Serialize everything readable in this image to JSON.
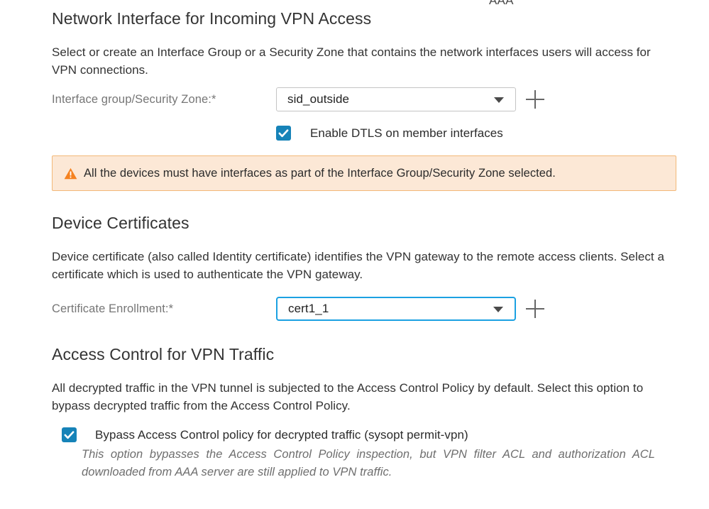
{
  "clipped_top_label": "AAA",
  "sections": {
    "network_interface": {
      "heading": "Network Interface for Incoming VPN Access",
      "description": "Select or create an Interface Group or a Security Zone that contains the network interfaces users will access for VPN connections.",
      "field_label": "Interface group/Security Zone:*",
      "selected_value": "sid_outside",
      "add_icon": "plus-icon",
      "caret_icon": "chevron-down-icon",
      "dtls_checkbox_label": "Enable DTLS on member interfaces",
      "dtls_checked": true,
      "warning": {
        "icon": "warning-triangle-icon",
        "text": "All the devices must have interfaces as part of the Interface Group/Security Zone selected."
      }
    },
    "device_certificates": {
      "heading": "Device Certificates",
      "description": "Device certificate (also called Identity certificate) identifies the VPN gateway to the remote access clients. Select a certificate which is used to authenticate the VPN gateway.",
      "field_label": "Certificate Enrollment:*",
      "selected_value": "cert1_1",
      "add_icon": "plus-icon",
      "caret_icon": "chevron-down-icon",
      "focused": true
    },
    "access_control": {
      "heading": "Access Control for VPN Traffic",
      "description": "All decrypted traffic in the VPN tunnel is subjected to the Access Control Policy by default. Select this option to bypass decrypted traffic from the Access Control Policy.",
      "bypass_checkbox_label": "Bypass Access Control policy for decrypted traffic (sysopt permit-vpn)",
      "bypass_checked": true,
      "bypass_hint": "This option bypasses the Access Control Policy inspection, but VPN filter ACL and authorization ACL downloaded from AAA server are still applied to VPN traffic."
    }
  },
  "colors": {
    "accent_blue": "#1683b8",
    "focus_blue": "#1ba1e2",
    "warning_bg": "#fce8d6",
    "warning_border": "#f3b878",
    "warning_icon": "#f58220",
    "label_gray": "#767676",
    "text_dark": "#2b2b2b"
  }
}
